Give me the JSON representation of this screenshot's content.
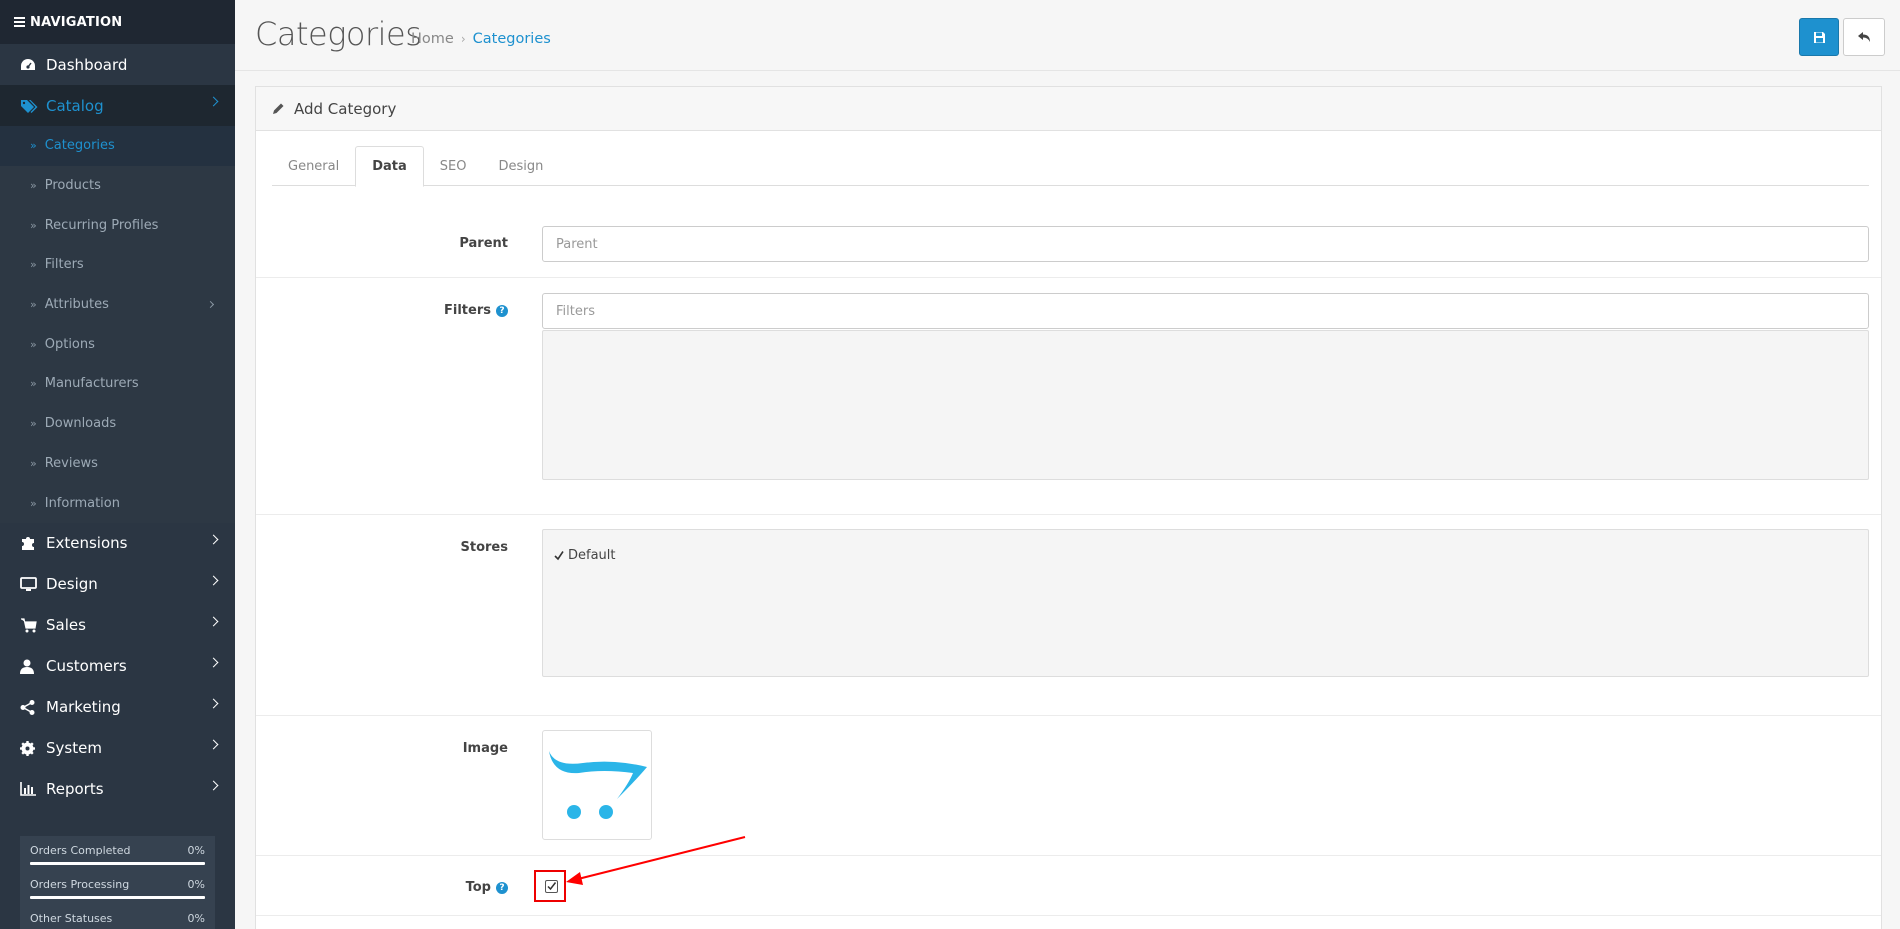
{
  "nav": {
    "header": "NAVIGATION",
    "items": [
      {
        "label": "Dashboard",
        "icon": "dashboard-icon"
      },
      {
        "label": "Catalog",
        "icon": "tags-icon"
      },
      {
        "label": "Extensions",
        "icon": "puzzle-icon"
      },
      {
        "label": "Design",
        "icon": "monitor-icon"
      },
      {
        "label": "Sales",
        "icon": "cart-icon"
      },
      {
        "label": "Customers",
        "icon": "user-icon"
      },
      {
        "label": "Marketing",
        "icon": "share-icon"
      },
      {
        "label": "System",
        "icon": "gear-icon"
      },
      {
        "label": "Reports",
        "icon": "bar-chart-icon"
      }
    ],
    "catalog_sub": [
      "Categories",
      "Products",
      "Recurring Profiles",
      "Filters",
      "Attributes",
      "Options",
      "Manufacturers",
      "Downloads",
      "Reviews",
      "Information"
    ],
    "stats": [
      {
        "label": "Orders Completed",
        "value": "0%"
      },
      {
        "label": "Orders Processing",
        "value": "0%"
      },
      {
        "label": "Other Statuses",
        "value": "0%"
      }
    ]
  },
  "header": {
    "title": "Categories",
    "breadcrumb": {
      "home": "Home",
      "current": "Categories"
    }
  },
  "panel": {
    "title": "Add Category",
    "tabs": [
      "General",
      "Data",
      "SEO",
      "Design"
    ],
    "active_tab": "Data"
  },
  "form": {
    "parent": {
      "label": "Parent",
      "placeholder": "Parent"
    },
    "filters": {
      "label": "Filters",
      "placeholder": "Filters"
    },
    "stores": {
      "label": "Stores",
      "items": [
        "Default"
      ]
    },
    "image": {
      "label": "Image"
    },
    "top": {
      "label": "Top",
      "checked": true
    }
  },
  "colors": {
    "accent": "#1e91cf",
    "sidebar": "#2b3643",
    "highlight": "#ff0000"
  }
}
